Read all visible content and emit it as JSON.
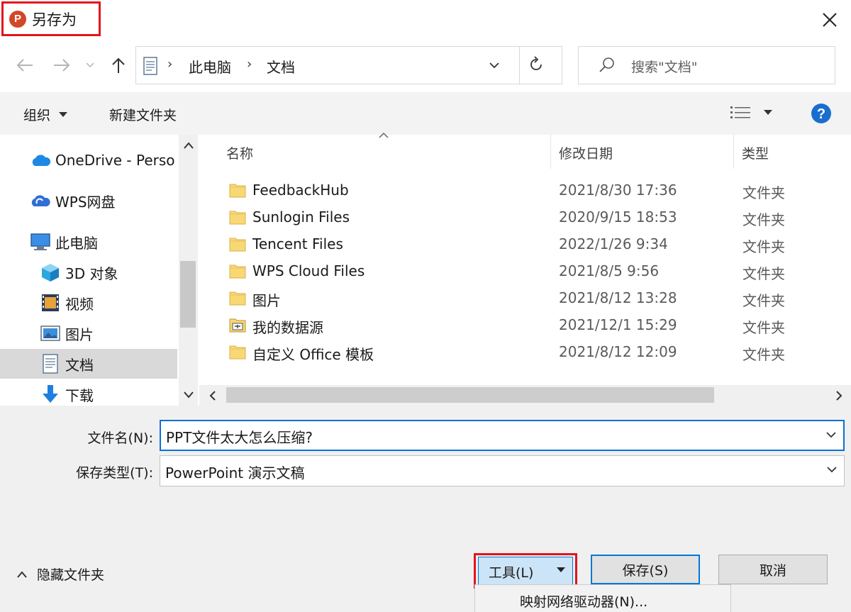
{
  "window": {
    "title": "另存为",
    "app_icon_letter": "P",
    "app_icon_color": "#d24726"
  },
  "address": {
    "breadcrumbs": [
      "此电脑",
      "文档"
    ],
    "search_placeholder": "搜索\"文档\""
  },
  "toolbar": {
    "organize_label": "组织",
    "new_folder_label": "新建文件夹"
  },
  "nav": {
    "items": [
      {
        "label": "OneDrive - Perso",
        "icon": "onedrive-cloud-icon"
      },
      {
        "label": "WPS网盘",
        "icon": "wps-cloud-icon"
      },
      {
        "label": "此电脑",
        "icon": "computer-icon"
      },
      {
        "label": "3D 对象",
        "icon": "3d-objects-icon"
      },
      {
        "label": "视频",
        "icon": "video-icon"
      },
      {
        "label": "图片",
        "icon": "pictures-icon"
      },
      {
        "label": "文档",
        "icon": "documents-icon"
      },
      {
        "label": "下载",
        "icon": "download-icon"
      }
    ],
    "selected_index": 6
  },
  "files": {
    "columns": {
      "name": "名称",
      "date": "修改日期",
      "type": "类型"
    },
    "rows": [
      {
        "name": "FeedbackHub",
        "date": "2021/8/30 17:36",
        "type": "文件夹",
        "icon": "folder-icon"
      },
      {
        "name": "Sunlogin Files",
        "date": "2020/9/15 18:53",
        "type": "文件夹",
        "icon": "folder-icon"
      },
      {
        "name": "Tencent Files",
        "date": "2022/1/26 9:34",
        "type": "文件夹",
        "icon": "folder-icon"
      },
      {
        "name": "WPS Cloud Files",
        "date": "2021/8/5 9:56",
        "type": "文件夹",
        "icon": "folder-icon"
      },
      {
        "name": "图片",
        "date": "2021/8/12 13:28",
        "type": "文件夹",
        "icon": "folder-icon"
      },
      {
        "name": "我的数据源",
        "date": "2021/12/1 15:29",
        "type": "文件夹",
        "icon": "data-source-folder-icon"
      },
      {
        "name": "自定义 Office 模板",
        "date": "2021/8/12 12:09",
        "type": "文件夹",
        "icon": "folder-icon"
      }
    ]
  },
  "form": {
    "filename_label": "文件名(N):",
    "filename_value": "PPT文件太大怎么压缩?",
    "filetype_label": "保存类型(T):",
    "filetype_value": "PowerPoint 演示文稿"
  },
  "footer": {
    "hide_folders_label": "隐藏文件夹",
    "tools_label": "工具(L)",
    "save_label": "保存(S)",
    "cancel_label": "取消",
    "tools_menu_item": "映射网络驱动器(N)..."
  },
  "colors": {
    "highlight_border": "#e3141c",
    "accent_blue": "#0078d7",
    "folder_yellow": "#f8d775"
  }
}
